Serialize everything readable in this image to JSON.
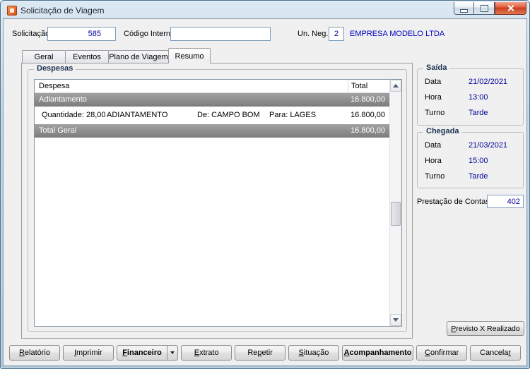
{
  "colors": {
    "value_text": "#000099",
    "company_text": "#0000C0",
    "selected_row_bg": "#8A8A8A",
    "selected_row_text": "#FFFFFF",
    "window_frame": "#49708F",
    "close_button_red": "#C63A1C",
    "group_title_text": "#1C3150"
  },
  "window": {
    "title": "Solicitação de Viagem"
  },
  "header": {
    "solicitacao_label": "Solicitação",
    "solicitacao_value": "585",
    "codigo_interno_label": "Código Interno",
    "codigo_interno_value": "",
    "un_neg_label": "Un. Neg.",
    "un_neg_value": "2",
    "empresa": "EMPRESA MODELO LTDA"
  },
  "tabs": [
    {
      "label": "Geral",
      "active": false
    },
    {
      "label": "Eventos",
      "active": false
    },
    {
      "label": "Plano de Viagem",
      "active": false
    },
    {
      "label": "Resumo",
      "active": true
    }
  ],
  "despesas": {
    "title": "Despesas",
    "col_despesa": "Despesa",
    "col_total": "Total",
    "row_adiantamento": {
      "label": "Adiantamento",
      "total": "16.800,00"
    },
    "row_detalhe": {
      "quantidade": "Quantidade: 28,00",
      "descricao": "ADIANTAMENTO",
      "origem": "De: CAMPO BOM",
      "destino": "Para: LAGES",
      "total": "16.800,00"
    },
    "row_total_geral": {
      "label": "Total Geral",
      "total": "16.800,00"
    }
  },
  "saida": {
    "title": "Saída",
    "data_label": "Data",
    "data_value": "21/02/2021",
    "hora_label": "Hora",
    "hora_value": "13:00",
    "turno_label": "Turno",
    "turno_value": "Tarde"
  },
  "chegada": {
    "title": "Chegada",
    "data_label": "Data",
    "data_value": "21/03/2021",
    "hora_label": "Hora",
    "hora_value": "15:00",
    "turno_label": "Turno",
    "turno_value": "Tarde"
  },
  "prestacao": {
    "label": "Prestação de Contas",
    "value": "402"
  },
  "previsto_realizado_button": "Previsto X Realizado",
  "footer": {
    "buttons": [
      {
        "label": "Relatório"
      },
      {
        "label": "Imprimir"
      },
      {
        "label": "Financeiro"
      },
      {
        "label": "Extrato"
      },
      {
        "label": "Repetir"
      },
      {
        "label": "Situação"
      },
      {
        "label": "Acompanhamento"
      },
      {
        "label": "Confirmar"
      },
      {
        "label": "Cancelar"
      }
    ]
  }
}
